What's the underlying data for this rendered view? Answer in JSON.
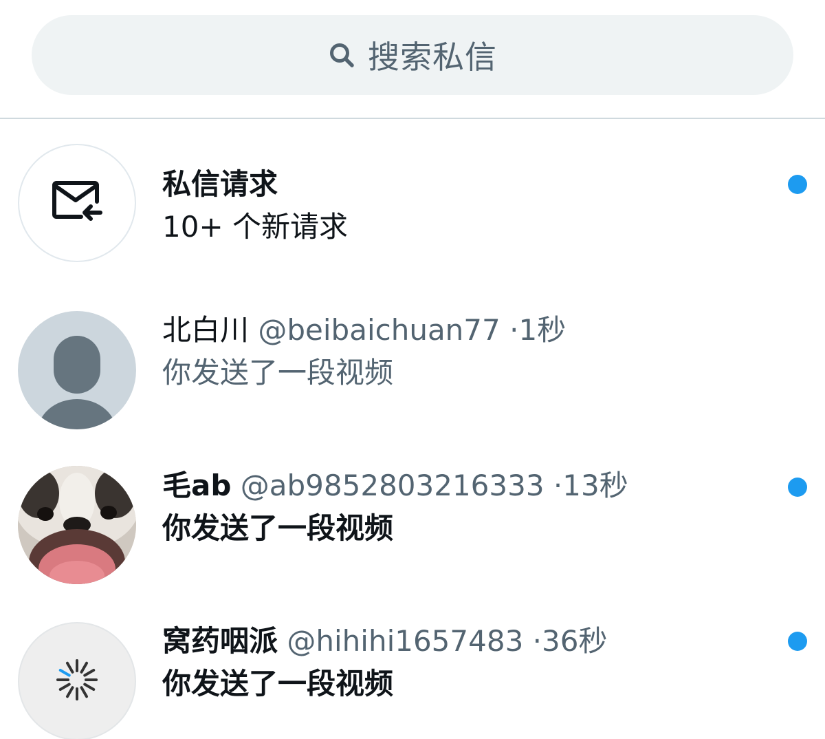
{
  "search": {
    "placeholder": "搜索私信",
    "icon": "search-icon"
  },
  "requests": {
    "title": "私信请求",
    "subtitle": "10+ 个新请求",
    "icon": "mail-request-icon",
    "unread": true
  },
  "conversations": [
    {
      "name": "北白川",
      "handle": "@beibaichuan77",
      "separator": "·",
      "time": "1秒",
      "preview": "你发送了一段视频",
      "unread": false,
      "avatar": "default-avatar"
    },
    {
      "name": "毛ab",
      "handle": "@ab9852803216333",
      "separator": "·",
      "time": "13秒",
      "preview": "你发送了一段视频",
      "unread": true,
      "avatar": "dog-photo-avatar"
    },
    {
      "name": "窝药咽派",
      "handle": "@hihihi1657483",
      "separator": "·",
      "time": "36秒",
      "preview": "你发送了一段视频",
      "unread": true,
      "avatar": "loading-avatar"
    }
  ],
  "colors": {
    "accent": "#1d9bf0",
    "text_primary": "#0f1419",
    "text_secondary": "#536471",
    "search_bg": "#eff3f4",
    "divider": "#cfd9de"
  }
}
